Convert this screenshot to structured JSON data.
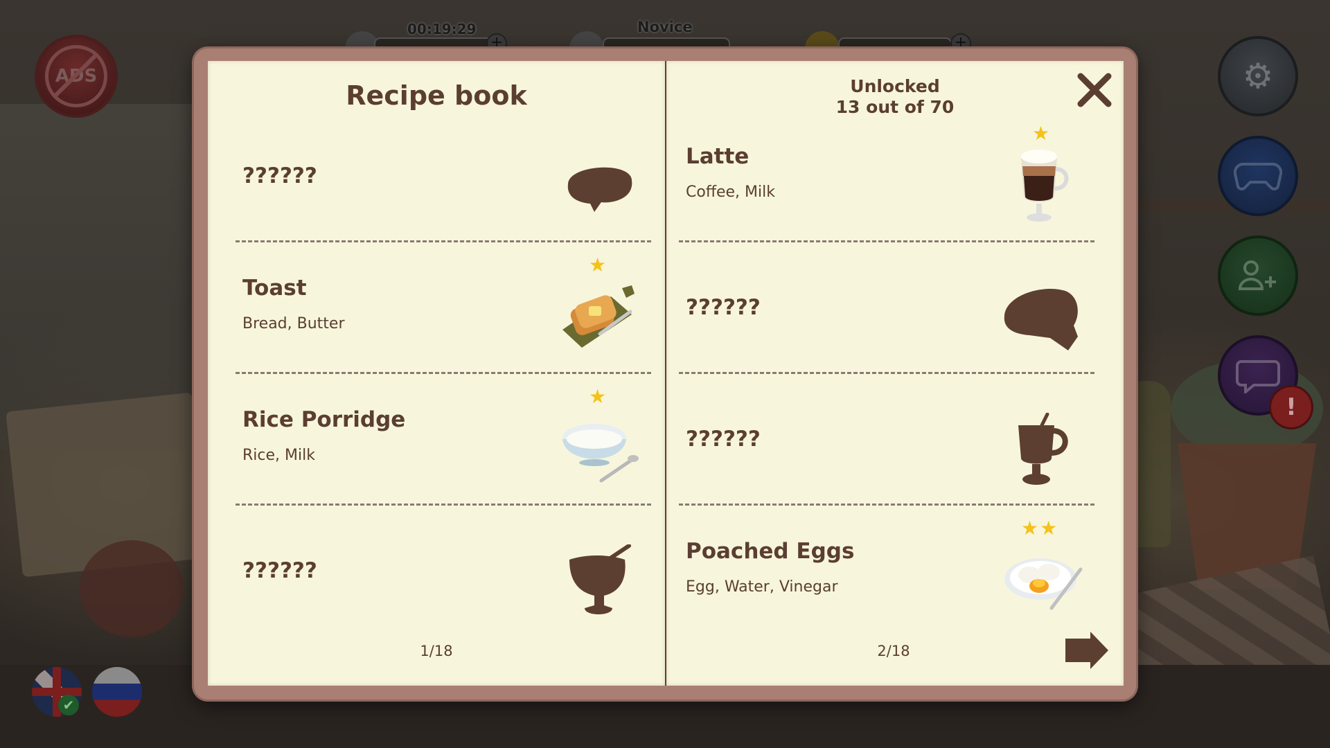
{
  "hud": {
    "timer": "00:19:29",
    "level": "Novice"
  },
  "sidebar": {
    "ads_label": "ADS",
    "alert_mark": "!"
  },
  "book": {
    "title": "Recipe book",
    "unlocked_label": "Unlocked",
    "unlocked_count": "13 out of 70",
    "close_icon": "close-icon",
    "next_icon": "arrow-right-icon",
    "left_page": {
      "page_number": "1/18",
      "recipes": [
        {
          "name": "??????",
          "ingredients": "",
          "stars": 0,
          "locked": true,
          "icon": "pie-silhouette"
        },
        {
          "name": "Toast",
          "ingredients": "Bread, Butter",
          "stars": 1,
          "locked": false,
          "icon": "toast-image"
        },
        {
          "name": "Rice Porridge",
          "ingredients": "Rice, Milk",
          "stars": 1,
          "locked": false,
          "icon": "rice-porridge-image"
        },
        {
          "name": "??????",
          "ingredients": "",
          "stars": 0,
          "locked": true,
          "icon": "dessert-cup-silhouette"
        }
      ]
    },
    "right_page": {
      "page_number": "2/18",
      "recipes": [
        {
          "name": "Latte",
          "ingredients": "Coffee, Milk",
          "stars": 1,
          "locked": false,
          "icon": "latte-image"
        },
        {
          "name": "??????",
          "ingredients": "",
          "stars": 0,
          "locked": true,
          "icon": "omelette-silhouette"
        },
        {
          "name": "??????",
          "ingredients": "",
          "stars": 0,
          "locked": true,
          "icon": "mug-silhouette"
        },
        {
          "name": "Poached Eggs",
          "ingredients": "Egg, Water, Vinegar",
          "stars": 2,
          "locked": false,
          "icon": "poached-eggs-image"
        }
      ]
    }
  },
  "colors": {
    "page_bg": "#f7f6dc",
    "text_brown": "#5b3e31",
    "frame": "#a97f74",
    "star": "#f5c21a",
    "silhouette": "#5d3f32"
  }
}
